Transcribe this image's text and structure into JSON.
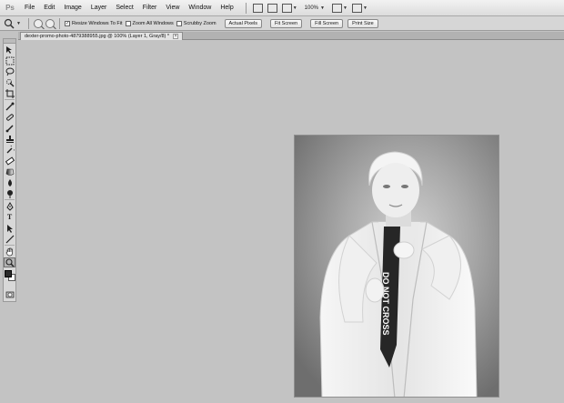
{
  "app": {
    "logo": "Ps"
  },
  "menu": [
    "File",
    "Edit",
    "Image",
    "Layer",
    "Select",
    "Filter",
    "View",
    "Window",
    "Help"
  ],
  "menubar_zoom": "100%",
  "options": {
    "resize_windows_label": "Resize Windows To Fit",
    "resize_windows_checked": true,
    "zoom_all_label": "Zoom All Windows",
    "zoom_all_checked": false,
    "scrubby_label": "Scrubby Zoom",
    "scrubby_checked": false,
    "actual_pixels": "Actual Pixels",
    "fit_screen": "Fit Screen",
    "fill_screen": "Fill Screen",
    "print_size": "Print Size"
  },
  "document": {
    "tab_title": "dexter-promo-photo-4879388955.jpg @ 100% (Layer 1, Gray/8) *",
    "close": "×"
  },
  "photo": {
    "tie_text": "DO NOT CROSS"
  },
  "tools": [
    "move-tool",
    "marquee-tool",
    "lasso-tool",
    "quick-select-tool",
    "crop-tool",
    "eyedropper-tool",
    "healing-brush-tool",
    "brush-tool",
    "clone-stamp-tool",
    "history-brush-tool",
    "eraser-tool",
    "gradient-tool",
    "blur-tool",
    "dodge-tool",
    "pen-tool",
    "type-tool",
    "path-selection-tool",
    "line-tool",
    "hand-tool",
    "zoom-tool"
  ],
  "colors": {
    "foreground": "#2a2a2a",
    "background": "#ffffff",
    "canvas_bg": "#c3c3c3"
  }
}
